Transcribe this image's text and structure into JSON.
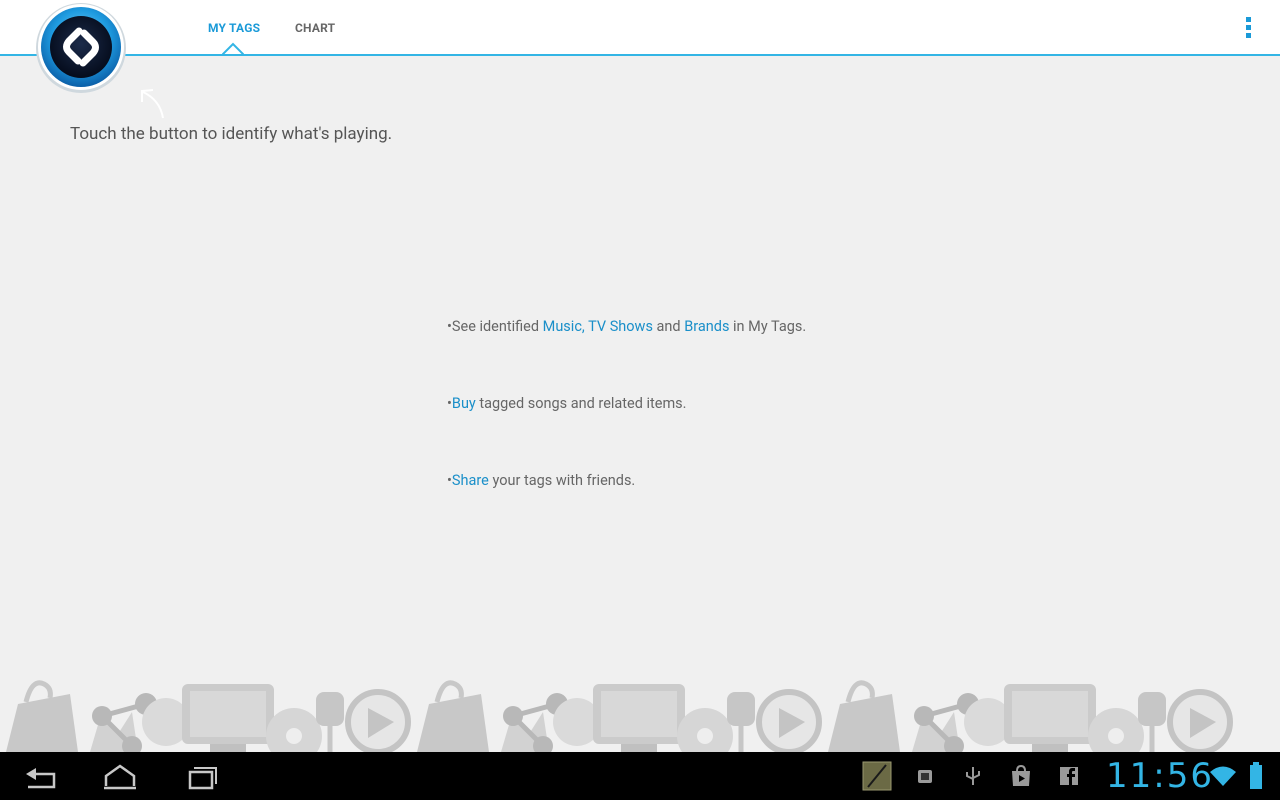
{
  "tabs": [
    {
      "label": "MY TAGS",
      "selected": true
    },
    {
      "label": "CHART",
      "selected": false
    }
  ],
  "hint": "Touch the button to identify what's playing.",
  "bullets": {
    "b1": {
      "prefix": "•See identified ",
      "link1": "Music,",
      "sep": " ",
      "link2": "TV Shows",
      "mid": " and ",
      "link3": "Brands",
      "suffix": " in My Tags."
    },
    "b2": {
      "prefix": "•",
      "link": "Buy",
      "suffix": " tagged songs and related items."
    },
    "b3": {
      "prefix": "•",
      "link": "Share",
      "suffix": " your tags with friends."
    }
  },
  "statusbar": {
    "time": "11:56"
  },
  "icons": {
    "logo": "shazam-logo-icon",
    "overflow": "overflow-menu-icon",
    "back": "back-icon",
    "home": "home-icon",
    "recents": "recent-apps-icon",
    "notifications": [
      "notes-notification-icon",
      "android-notification-icon",
      "usb-notification-icon",
      "play-store-notification-icon",
      "facebook-notification-icon"
    ],
    "wifi": "wifi-icon",
    "battery": "battery-icon"
  },
  "colors": {
    "accent": "#33b5e5",
    "link": "#1a8fc9",
    "tab_active": "#1a9ad8",
    "background": "#f0f0f0"
  }
}
